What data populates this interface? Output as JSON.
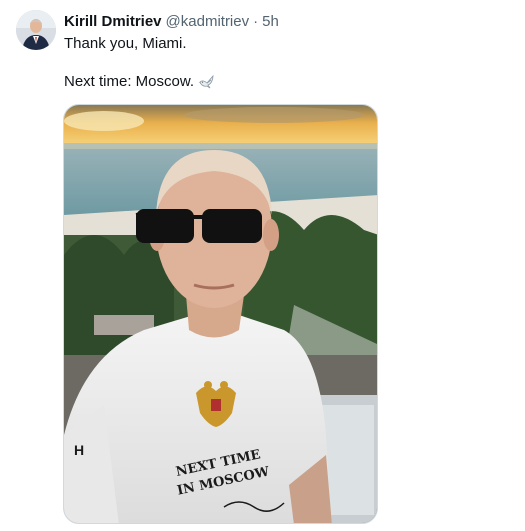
{
  "tweet": {
    "author": {
      "display_name": "Kirill Dmitriev",
      "handle": "@kadmitriev",
      "separator": "·",
      "time": "5h"
    },
    "text_line_1": "Thank you, Miami.",
    "text_line_2": "Next time: Moscow.",
    "emoji": "dove-icon",
    "photo": {
      "shirt_text": "NEXT TIME\nIN MOSCOW",
      "shirt_line_1": "NEXT TIME",
      "shirt_line_2": "IN MOSCOW",
      "sleeve_text": "H"
    }
  },
  "colors": {
    "text_primary": "#0f1419",
    "text_secondary": "#536471",
    "border": "#cfd9de"
  }
}
